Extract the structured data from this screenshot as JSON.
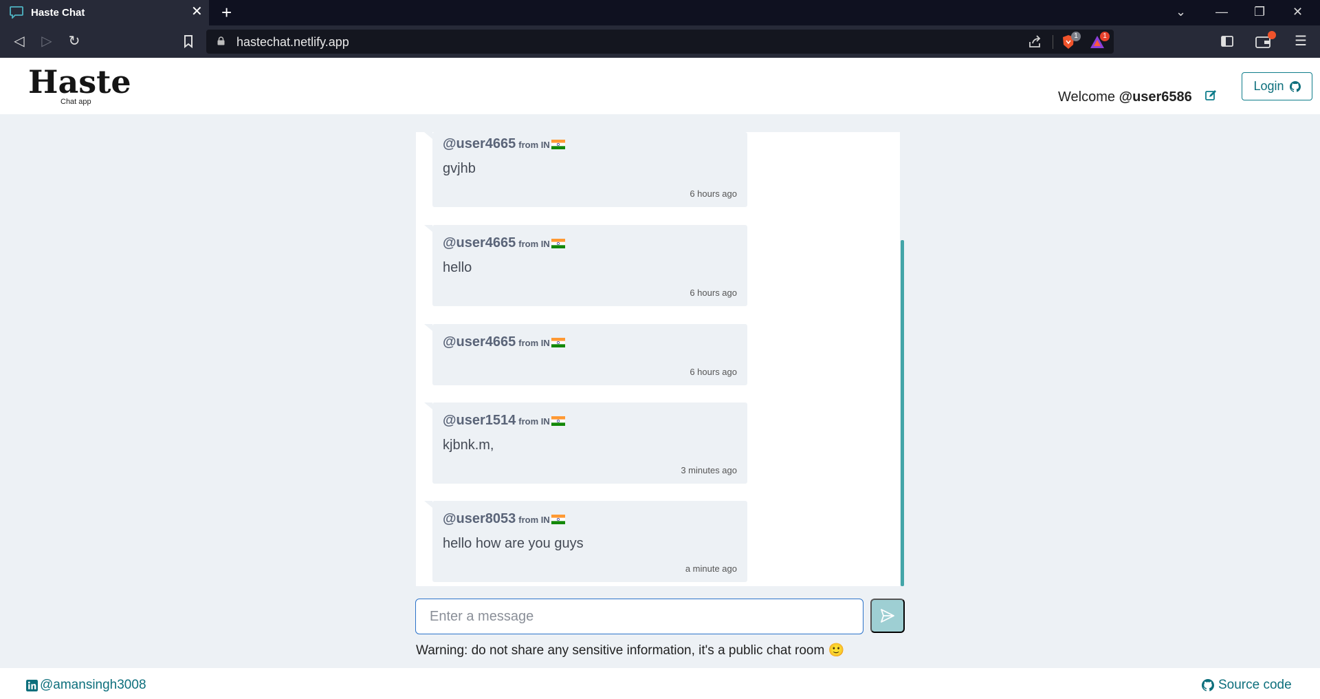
{
  "browser": {
    "tab_title": "Haste Chat",
    "tab_close": "✕",
    "new_tab": "+",
    "url": "hastechat.netlify.app",
    "brave_badge": "1",
    "rewards_badge": "1"
  },
  "header": {
    "logo": "Haste",
    "logo_subtitle": "Chat app",
    "welcome_prefix": "Welcome",
    "username": "@user6586",
    "login_label": "Login"
  },
  "messages": [
    {
      "user": "@user4665",
      "from": "from IN",
      "text": "gvjhb",
      "time": "6 hours ago"
    },
    {
      "user": "@user4665",
      "from": "from IN",
      "text": "hello",
      "time": "6 hours ago"
    },
    {
      "user": "@user4665",
      "from": "from IN",
      "text": "",
      "time": "6 hours ago"
    },
    {
      "user": "@user1514",
      "from": "from IN",
      "text": "kjbnk.m,",
      "time": "3 minutes ago"
    },
    {
      "user": "@user8053",
      "from": "from IN",
      "text": "hello how are you guys",
      "time": "a minute ago"
    }
  ],
  "composer": {
    "placeholder": "Enter a message"
  },
  "warning": "Warning: do not share any sensitive information, it's a public chat room 🙂",
  "footer": {
    "linkedin": "@amansingh3008",
    "source": "Source code"
  },
  "colors": {
    "accent": "#0d7c8a",
    "send_button": "#9ecfd3",
    "input_border": "#2a72c9"
  }
}
